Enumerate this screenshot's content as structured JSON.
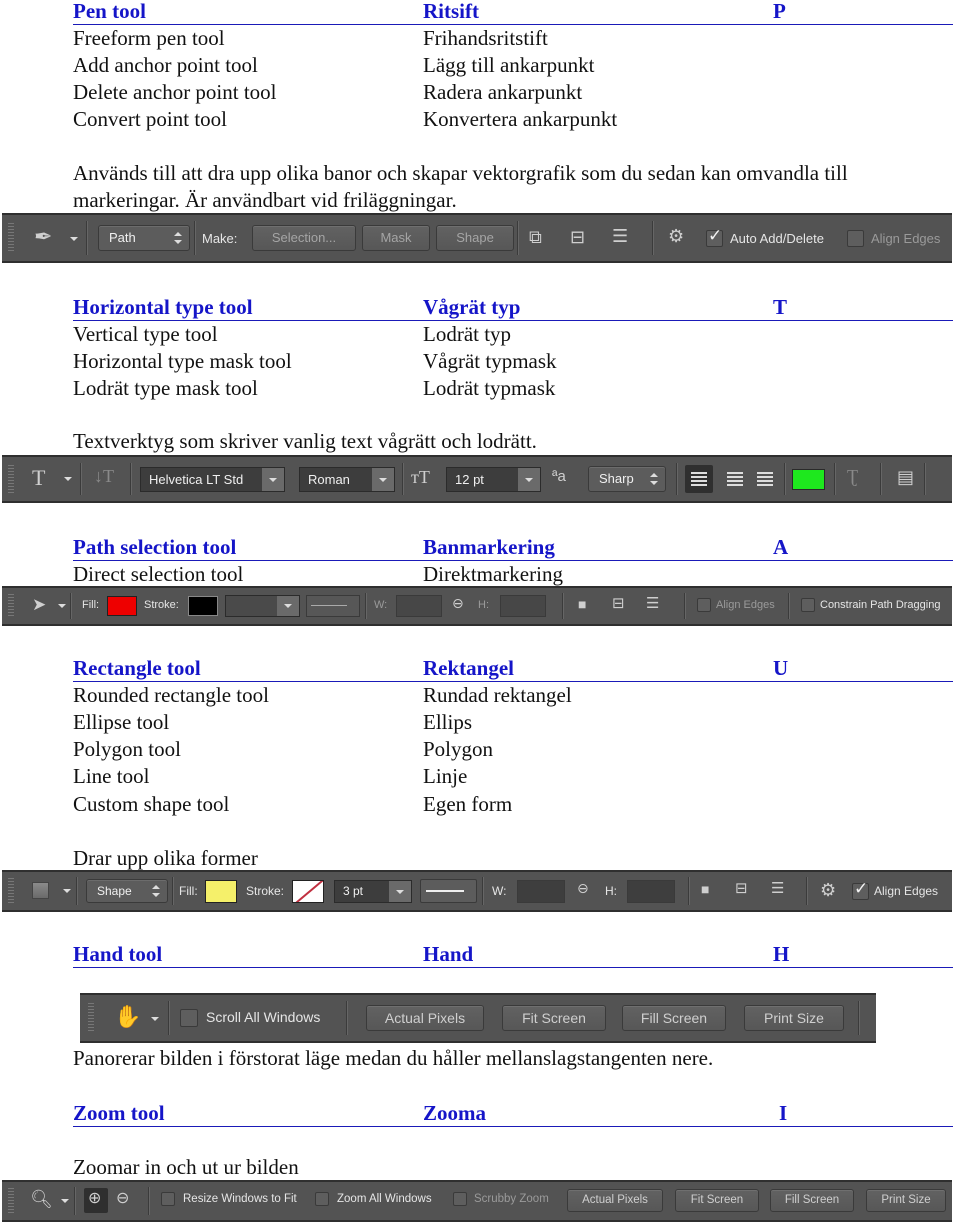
{
  "sections": [
    {
      "heading": {
        "en": "Pen tool",
        "sv": "Ritsift",
        "key": "P"
      },
      "rows": [
        {
          "en": "Freeform pen tool",
          "sv": "Frihandsritstift"
        },
        {
          "en": "Add anchor point tool",
          "sv": "Lägg till ankarpunkt"
        },
        {
          "en": "Delete anchor point tool",
          "sv": "Radera ankarpunkt"
        },
        {
          "en": "Convert point tool",
          "sv": "Konvertera ankarpunkt"
        }
      ],
      "description": "Används till att dra upp olika banor och skapar vektorgrafik som du sedan kan omvandla till markeringar. Är användbart vid friläggningar."
    },
    {
      "heading": {
        "en": "Horizontal type tool",
        "sv": "Vågrät typ",
        "key": "T"
      },
      "rows": [
        {
          "en": "Vertical type tool",
          "sv": "Lodrät typ"
        },
        {
          "en": "Horizontal type mask tool",
          "sv": "Vågrät typmask"
        },
        {
          "en": "Lodrät type mask tool",
          "sv": "Lodrät typmask"
        }
      ],
      "description": "Textverktyg som skriver vanlig text vågrätt och lodrätt."
    },
    {
      "heading": {
        "en": "Path selection tool",
        "sv": "Banmarkering",
        "key": "A"
      },
      "rows": [
        {
          "en": "Direct selection tool",
          "sv": "Direktmarkering"
        }
      ]
    },
    {
      "heading": {
        "en": "Rectangle tool",
        "sv": "Rektangel",
        "key": "U"
      },
      "rows": [
        {
          "en": "Rounded rectangle tool",
          "sv": "Rundad rektangel"
        },
        {
          "en": "Ellipse tool",
          "sv": "Ellips"
        },
        {
          "en": "Polygon tool",
          "sv": "Polygon"
        },
        {
          "en": "Line tool",
          "sv": "Linje"
        },
        {
          "en": "Custom shape tool",
          "sv": "Egen form"
        }
      ],
      "description": "Drar upp olika former"
    },
    {
      "heading": {
        "en": "Hand tool",
        "sv": "Hand",
        "key": "H"
      },
      "description": "Panorerar bilden i förstorat läge medan du håller mellanslagstangenten nere."
    },
    {
      "heading": {
        "en": "Zoom tool",
        "sv": "Zooma",
        "key": "I"
      },
      "description": "Zoomar in och ut ur bilden"
    }
  ],
  "toolbars": {
    "pen": {
      "mode": "Path",
      "make_label": "Make:",
      "selection": "Selection...",
      "mask": "Mask",
      "shape": "Shape",
      "auto_add_delete": "Auto Add/Delete",
      "auto_add_delete_checked": true,
      "align_edges": "Align Edges",
      "align_edges_checked": false
    },
    "type": {
      "font_family": "Helvetica LT Std",
      "font_style": "Roman",
      "font_size": "12 pt",
      "antialias": "Sharp",
      "text_color": "#1ee81e"
    },
    "path_select": {
      "fill_label": "Fill:",
      "fill_color": "#ee0000",
      "stroke_label": "Stroke:",
      "stroke_color": "#000000",
      "w_label": "W:",
      "h_label": "H:",
      "align_edges": "Align Edges",
      "constrain": "Constrain Path Dragging"
    },
    "shape": {
      "mode": "Shape",
      "fill_label": "Fill:",
      "fill_color": "#f5f06a",
      "stroke_label": "Stroke:",
      "stroke_width": "3 pt",
      "w_label": "W:",
      "h_label": "H:",
      "align_edges": "Align Edges",
      "align_edges_checked": true
    },
    "hand": {
      "scroll_all": "Scroll All Windows",
      "actual_pixels": "Actual Pixels",
      "fit_screen": "Fit Screen",
      "fill_screen": "Fill Screen",
      "print_size": "Print Size"
    },
    "zoom": {
      "resize_windows": "Resize Windows to Fit",
      "zoom_all": "Zoom All Windows",
      "scrubby": "Scrubby Zoom",
      "actual_pixels": "Actual Pixels",
      "fit_screen": "Fit Screen",
      "fill_screen": "Fill Screen",
      "print_size": "Print Size"
    }
  }
}
